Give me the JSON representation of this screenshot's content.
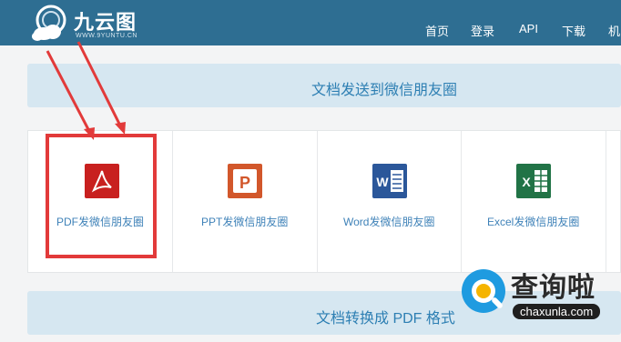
{
  "header": {
    "logo_name": "九云图",
    "logo_domain": "WWW.9YUNTU.CN",
    "nav": [
      "首页",
      "登录",
      "API",
      "下载",
      "机"
    ]
  },
  "section1": {
    "title": "文档发送到微信朋友圈",
    "cards": [
      {
        "label": "PDF发微信朋友圈",
        "icon": "pdf-icon",
        "color": "#c8201f"
      },
      {
        "label": "PPT发微信朋友圈",
        "icon": "powerpoint-icon",
        "color": "#d2572b"
      },
      {
        "label": "Word发微信朋友圈",
        "icon": "word-icon",
        "color": "#2b579a"
      },
      {
        "label": "Excel发微信朋友圈",
        "icon": "excel-icon",
        "color": "#217346"
      }
    ]
  },
  "section2": {
    "title": "文档转换成 PDF 格式"
  },
  "watermark": {
    "text": "查询啦",
    "domain": "chaxunla.com"
  },
  "colors": {
    "header_bg": "#2e6e92",
    "banner_bg": "#d6e7f1",
    "banner_text": "#2d7fb3",
    "annotation_red": "#e23a3a"
  }
}
